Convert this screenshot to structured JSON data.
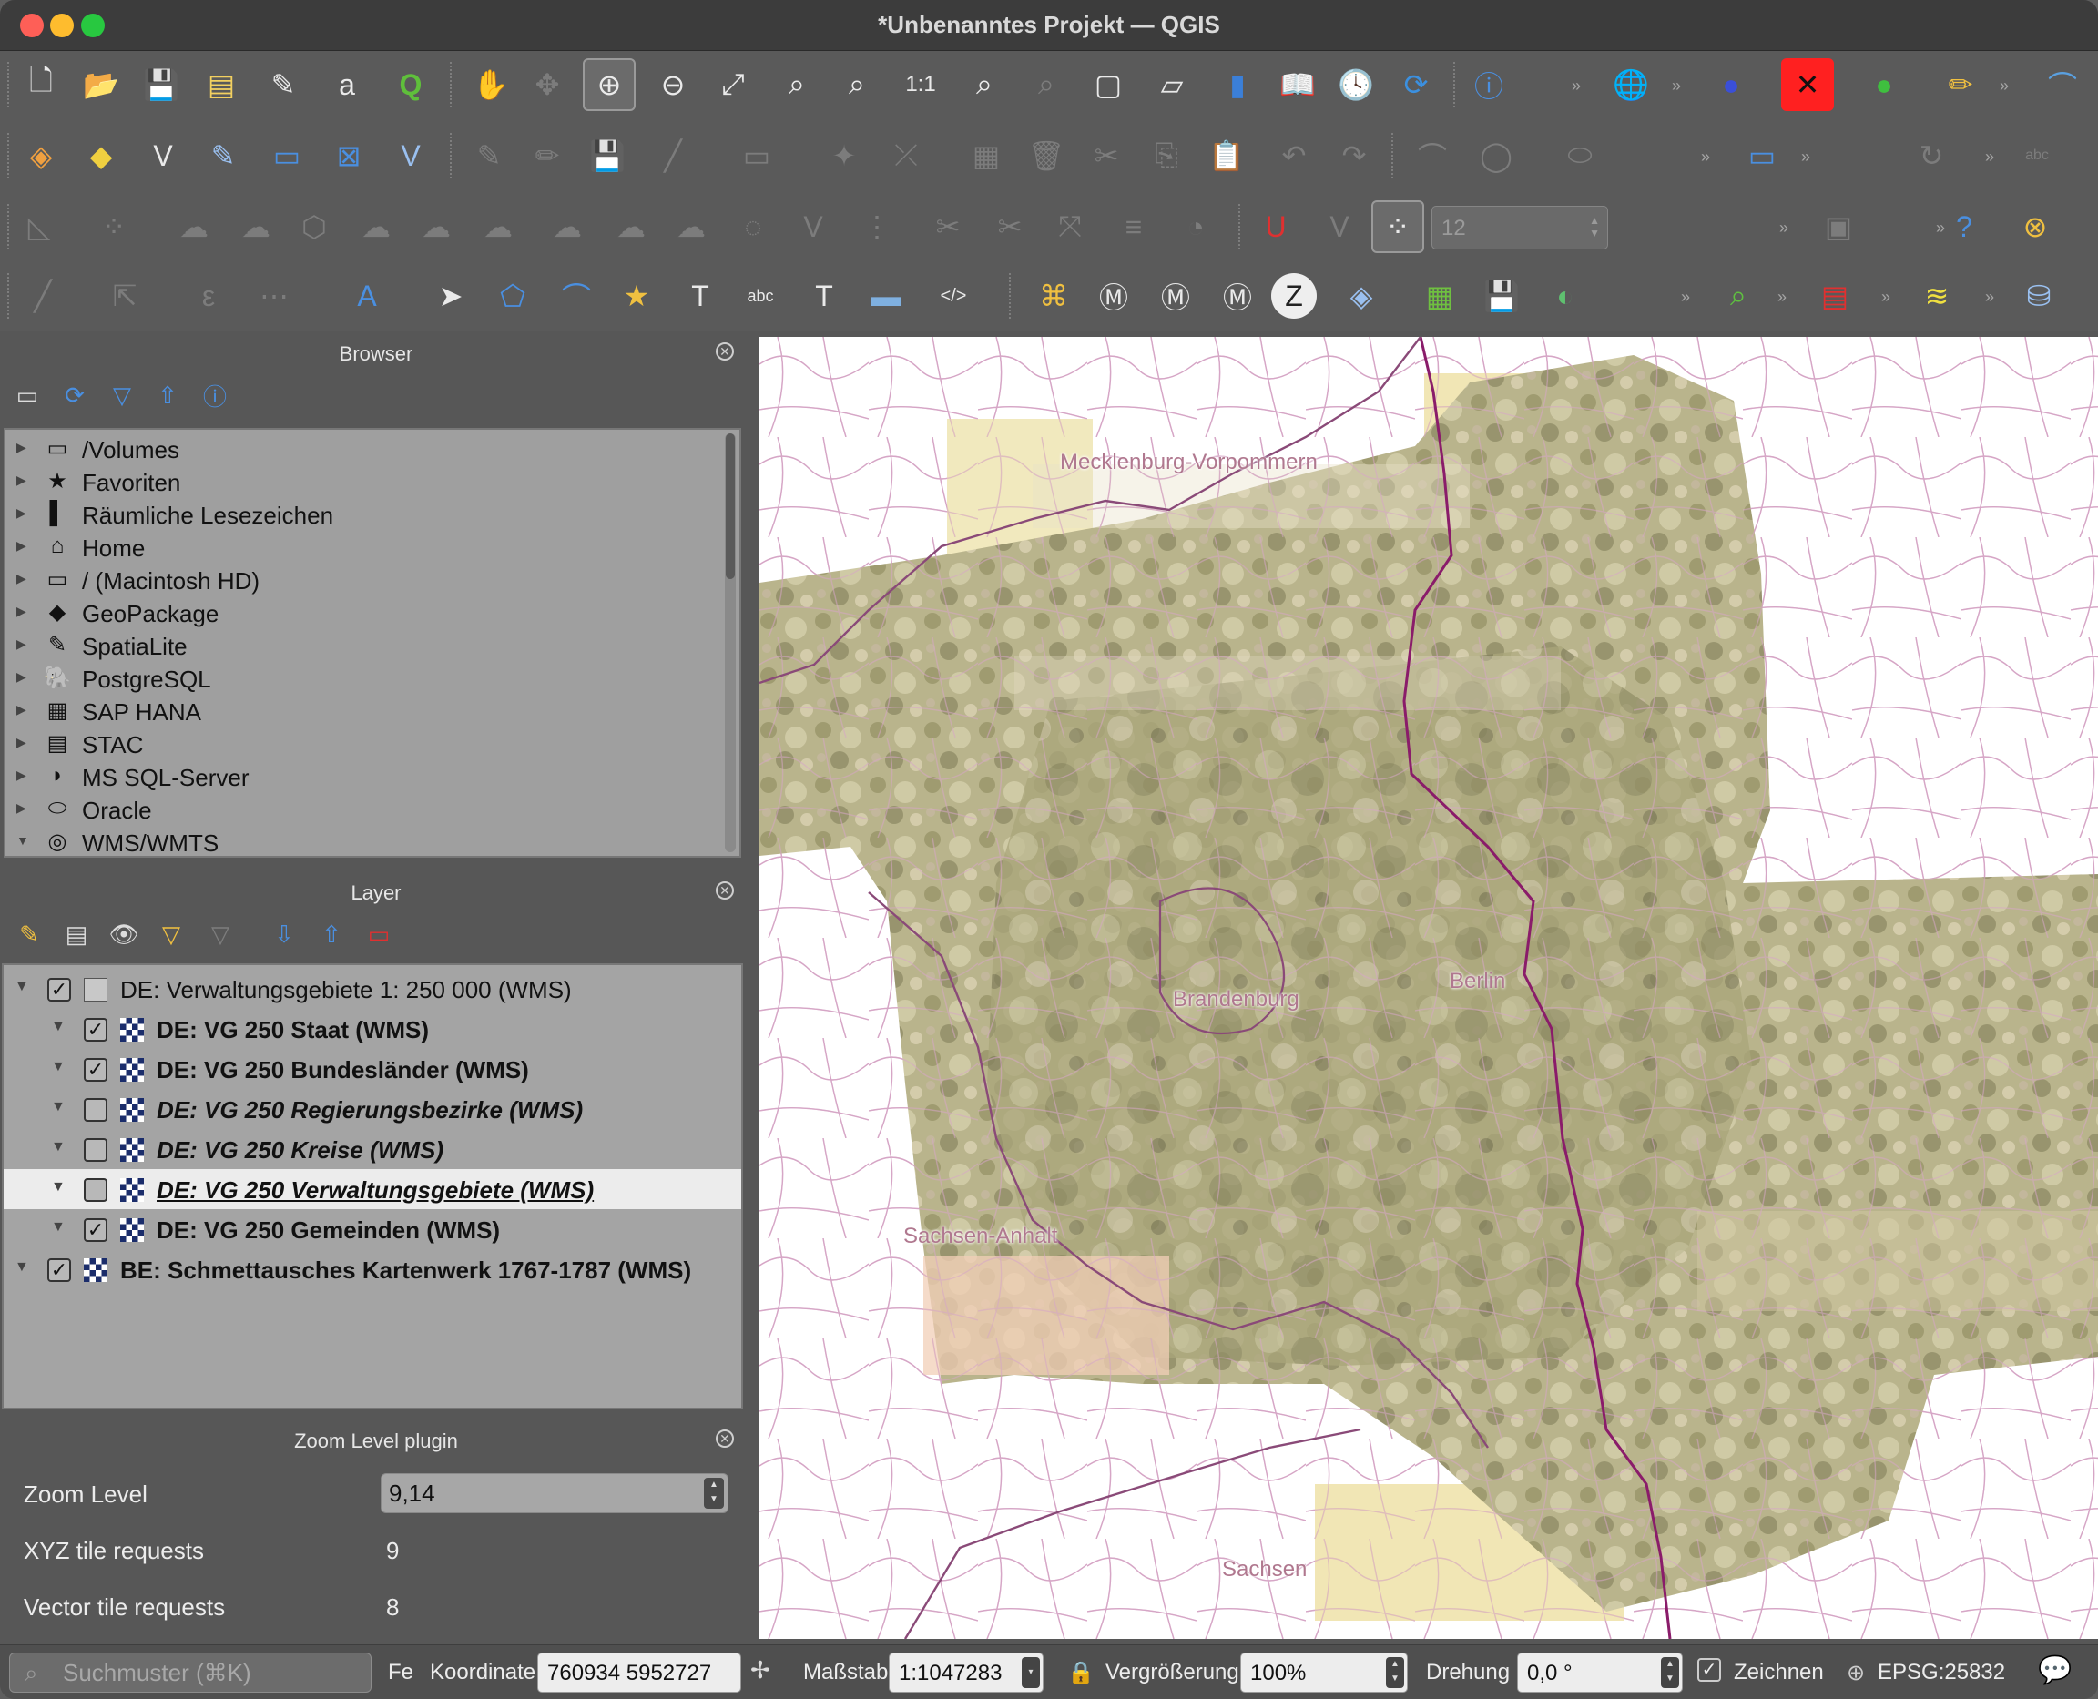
{
  "window": {
    "title": "*Unbenanntes Projekt — QGIS"
  },
  "toolbar": {
    "row1_icons": [
      "new-project",
      "open-project",
      "save-project",
      "new-print-layout",
      "layout-manager",
      "style-manager",
      "qgis-logo",
      "pan",
      "pan-to-selection",
      "zoom-in",
      "zoom-out",
      "zoom-full",
      "zoom-to-selection",
      "zoom-to-layer",
      "zoom-native",
      "zoom-last",
      "zoom-next",
      "new-bookmark",
      "show-bookmarks",
      "new-spatial-bookmark",
      "spatial-bookmarks",
      "temporal-controller",
      "refresh",
      "identify",
      "wms-search",
      "nextgis-plugin",
      "close-red",
      "share",
      "digitize-plugin"
    ],
    "snapping_tolerance": "12"
  },
  "browser": {
    "title": "Browser",
    "items": [
      {
        "label": "/Volumes",
        "icon": "folder-icon",
        "glyph": "▭"
      },
      {
        "label": "Favoriten",
        "icon": "star-icon",
        "glyph": "★"
      },
      {
        "label": "Räumliche Lesezeichen",
        "icon": "bookmark-icon",
        "glyph": "▌"
      },
      {
        "label": "Home",
        "icon": "home-icon",
        "glyph": "⌂"
      },
      {
        "label": "/ (Macintosh HD)",
        "icon": "folder-icon",
        "glyph": "▭"
      },
      {
        "label": "GeoPackage",
        "icon": "geopackage-icon",
        "glyph": "◆"
      },
      {
        "label": "SpatiaLite",
        "icon": "feather-icon",
        "glyph": "✎"
      },
      {
        "label": "PostgreSQL",
        "icon": "elephant-icon",
        "glyph": "🐘"
      },
      {
        "label": "SAP HANA",
        "icon": "sap-hana-icon",
        "glyph": "▦"
      },
      {
        "label": "STAC",
        "icon": "stac-icon",
        "glyph": "▤"
      },
      {
        "label": "MS SQL-Server",
        "icon": "mssql-icon",
        "glyph": "◗"
      },
      {
        "label": "Oracle",
        "icon": "oracle-icon",
        "glyph": "⬭"
      },
      {
        "label": "WMS/WMTS",
        "icon": "globe-icon",
        "glyph": "◎"
      }
    ]
  },
  "layers": {
    "title": "Layer",
    "items": [
      {
        "label": "DE: Verwaltungsgebiete 1: 250 000 (WMS)",
        "checked": "✓",
        "indent": 0,
        "group": true
      },
      {
        "label": "DE: VG 250 Staat (WMS)",
        "checked": "✓",
        "indent": 1
      },
      {
        "label": "DE: VG 250 Bundesländer (WMS)",
        "checked": "✓",
        "indent": 1
      },
      {
        "label": "DE: VG 250 Regierungsbezirke (WMS)",
        "checked": "",
        "indent": 1,
        "italic": true
      },
      {
        "label": "DE: VG 250 Kreise (WMS)",
        "checked": "",
        "indent": 1,
        "italic": true
      },
      {
        "label": "DE: VG 250 Verwaltungsgebiete (WMS)",
        "checked": "",
        "indent": 1,
        "italic": true,
        "selected": true
      },
      {
        "label": "DE: VG 250 Gemeinden (WMS)",
        "checked": "✓",
        "indent": 1
      },
      {
        "label": "BE: Schmettausches Kartenwerk 1767-1787 (WMS)",
        "checked": "✓",
        "indent": 0
      }
    ]
  },
  "zoom_plugin": {
    "title": "Zoom Level plugin",
    "zoom_level_label": "Zoom Level",
    "zoom_level_value": "9,14",
    "xyz_label": "XYZ tile requests",
    "xyz_value": "9",
    "vector_label": "Vector tile requests",
    "vector_value": "8"
  },
  "map": {
    "labels": {
      "mv": "Mecklenburg-Vorpommern",
      "brandenburg": "Brandenburg",
      "berlin": "Berlin",
      "sachsen_anhalt": "Sachsen-Anhalt",
      "sachsen": "Sachsen"
    }
  },
  "statusbar": {
    "search_placeholder": "Suchmuster (⌘K)",
    "fe_label": "Fe",
    "koordinate_label": "Koordinate",
    "koordinate_value": "760934  5952727",
    "massstab_label": "Maßstab",
    "massstab_value": "1:1047283",
    "vergroesserung_label": "Vergrößerung",
    "vergroesserung_value": "100%",
    "drehung_label": "Drehung",
    "drehung_value": "0,0 °",
    "zeichnen_label": "Zeichnen",
    "crs": "EPSG:25832"
  },
  "colors": {
    "accent": "#1e88e5",
    "map_boundary": "#c68fb0",
    "state_boundary": "#8a1c6a"
  }
}
